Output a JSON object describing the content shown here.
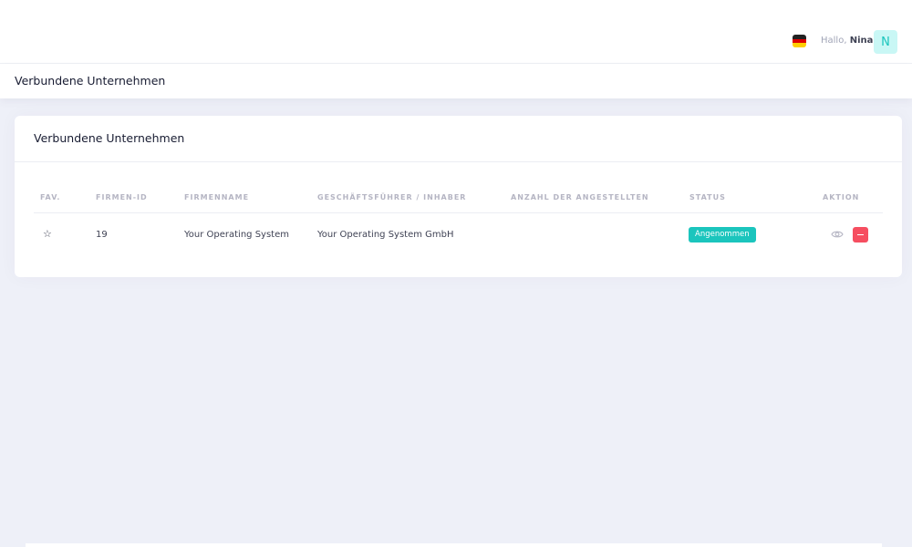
{
  "header": {
    "greeting_prefix": "Hallo,",
    "user_name": "Nina",
    "avatar_initial": "N",
    "language_icon": "flag-de-icon"
  },
  "subheader": {
    "title": "Verbundene Unternehmen"
  },
  "card": {
    "title": "Verbundene Unternehmen",
    "columns": [
      "FAV.",
      "FIRMEN-ID",
      "FIRMENNAME",
      "GESCHÄFTSFÜHRER / INHABER",
      "ANZAHL DER ANGESTELLTEN",
      "STATUS",
      "AKTION"
    ],
    "rows": [
      {
        "fav_icon": "star-outline-icon",
        "fav_glyph": "☆",
        "company_id": "19",
        "company_name": "Your Operating System",
        "owner": "Your Operating System GmbH",
        "employees": "",
        "status": "Angenommen",
        "actions": [
          "eye-icon",
          "minus-icon"
        ]
      }
    ]
  },
  "colors": {
    "background": "#eef0f8",
    "status_success": "#1bc5bd",
    "danger": "#f64e60",
    "avatar_bg": "#c9f7f5"
  }
}
